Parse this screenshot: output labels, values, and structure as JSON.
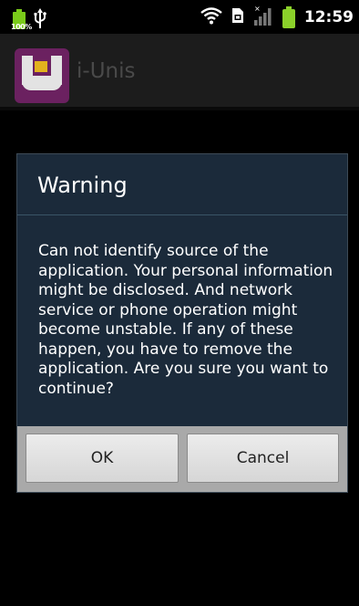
{
  "status_bar": {
    "battery_percent_label": "100%",
    "usb_icon": "usb-icon",
    "wifi_icon": "wifi-icon",
    "sim_icon": "sim-card-icon",
    "signal_icon": "signal-icon",
    "battery_icon": "battery-icon",
    "time": "12:59"
  },
  "app_bar": {
    "title": "i-Unis",
    "icon": "app-icon"
  },
  "dialog": {
    "title": "Warning",
    "message": "Can not identify source of the application. Your personal information might be disclosed. And network service or phone operation might become unstable. If any of these happen, you have to remove the application. Are you sure you want to continue?",
    "buttons": {
      "ok": "OK",
      "cancel": "Cancel"
    }
  },
  "colors": {
    "dialog_background": "#1b2a3a",
    "battery_green": "#8bd12a",
    "app_icon_purple": "#6b2160"
  }
}
